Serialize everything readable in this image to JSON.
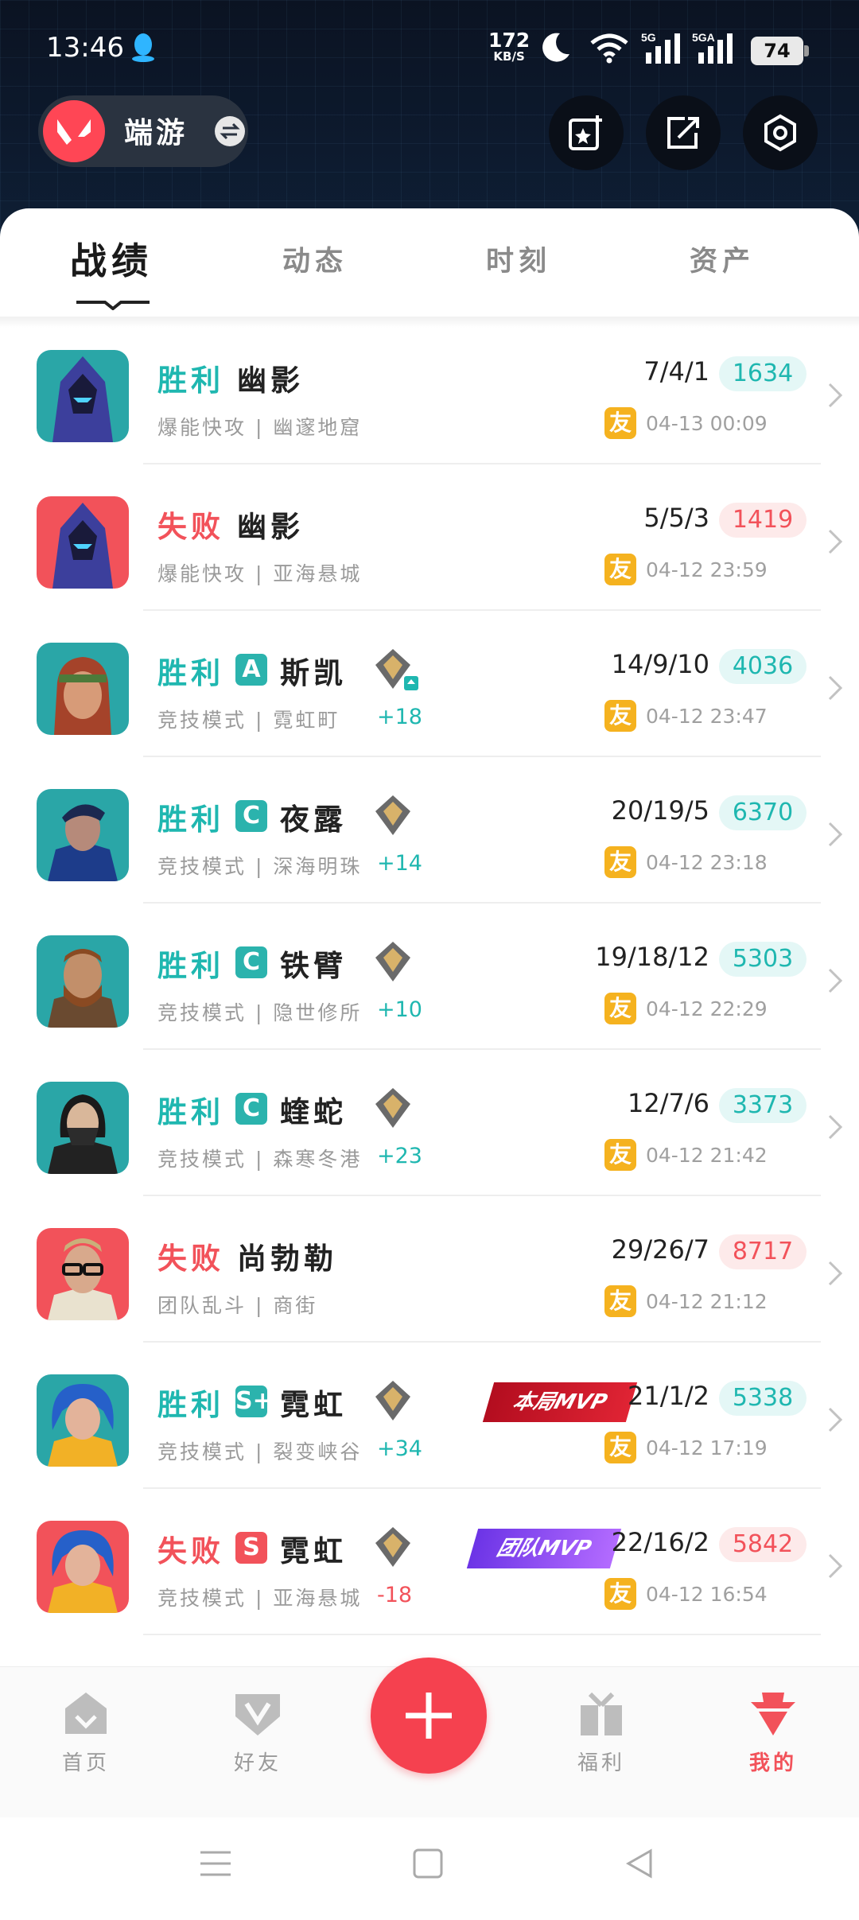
{
  "status_bar": {
    "time": "13:46",
    "net_speed": "172",
    "net_unit": "KB/S",
    "sim1": "5G",
    "sim2": "5GA",
    "battery": "74"
  },
  "header": {
    "game_name": "端游"
  },
  "tabs": [
    {
      "label": "战绩"
    },
    {
      "label": "动态"
    },
    {
      "label": "时刻"
    },
    {
      "label": "资产"
    }
  ],
  "matches": [
    {
      "result": "胜利",
      "tier": "",
      "agent": "幽影",
      "mode": "爆能快攻",
      "map": "幽邃地窟",
      "rank_change": "",
      "kda": "7/4/1",
      "score": "1634",
      "date": "04-13 00:09",
      "friend": "友",
      "mvp": ""
    },
    {
      "result": "失败",
      "tier": "",
      "agent": "幽影",
      "mode": "爆能快攻",
      "map": "亚海悬城",
      "rank_change": "",
      "kda": "5/5/3",
      "score": "1419",
      "date": "04-12 23:59",
      "friend": "友",
      "mvp": ""
    },
    {
      "result": "胜利",
      "tier": "A",
      "agent": "斯凯",
      "mode": "竞技模式",
      "map": "霓虹町",
      "rank_change": "+18",
      "kda": "14/9/10",
      "score": "4036",
      "date": "04-12 23:47",
      "friend": "友",
      "mvp": ""
    },
    {
      "result": "胜利",
      "tier": "C",
      "agent": "夜露",
      "mode": "竞技模式",
      "map": "深海明珠",
      "rank_change": "+14",
      "kda": "20/19/5",
      "score": "6370",
      "date": "04-12 23:18",
      "friend": "友",
      "mvp": ""
    },
    {
      "result": "胜利",
      "tier": "C",
      "agent": "铁臂",
      "mode": "竞技模式",
      "map": "隐世修所",
      "rank_change": "+10",
      "kda": "19/18/12",
      "score": "5303",
      "date": "04-12 22:29",
      "friend": "友",
      "mvp": ""
    },
    {
      "result": "胜利",
      "tier": "C",
      "agent": "蝰蛇",
      "mode": "竞技模式",
      "map": "森寒冬港",
      "rank_change": "+23",
      "kda": "12/7/6",
      "score": "3373",
      "date": "04-12 21:42",
      "friend": "友",
      "mvp": ""
    },
    {
      "result": "失败",
      "tier": "",
      "agent": "尚勃勒",
      "mode": "团队乱斗",
      "map": "商街",
      "rank_change": "",
      "kda": "29/26/7",
      "score": "8717",
      "date": "04-12 21:12",
      "friend": "友",
      "mvp": ""
    },
    {
      "result": "胜利",
      "tier": "S+",
      "agent": "霓虹",
      "mode": "竞技模式",
      "map": "裂变峡谷",
      "rank_change": "+34",
      "kda": "21/1/2",
      "score": "5338",
      "date": "04-12 17:19",
      "friend": "友",
      "mvp": "本局MVP"
    },
    {
      "result": "失败",
      "tier": "S",
      "agent": "霓虹",
      "mode": "竞技模式",
      "map": "亚海悬城",
      "rank_change": "-18",
      "kda": "22/16/2",
      "score": "5842",
      "date": "04-12 16:54",
      "friend": "友",
      "mvp": "团队MVP"
    }
  ],
  "bottom_nav": [
    {
      "label": "首页"
    },
    {
      "label": "好友"
    },
    {
      "label": "福利"
    },
    {
      "label": "我的"
    }
  ],
  "colors": {
    "win": "#1fb7b0",
    "lose": "#f2525a",
    "accent": "#f5414f",
    "friend_badge": "#f5b21f"
  },
  "icons": [
    "qq-icon",
    "moon-icon",
    "wifi-icon",
    "signal-icon",
    "add-post-icon",
    "share-icon",
    "settings-hex-icon",
    "chevron-right-icon",
    "rank-diamond-icon",
    "home-icon",
    "friends-icon",
    "gift-icon",
    "me-icon",
    "plus-icon"
  ]
}
